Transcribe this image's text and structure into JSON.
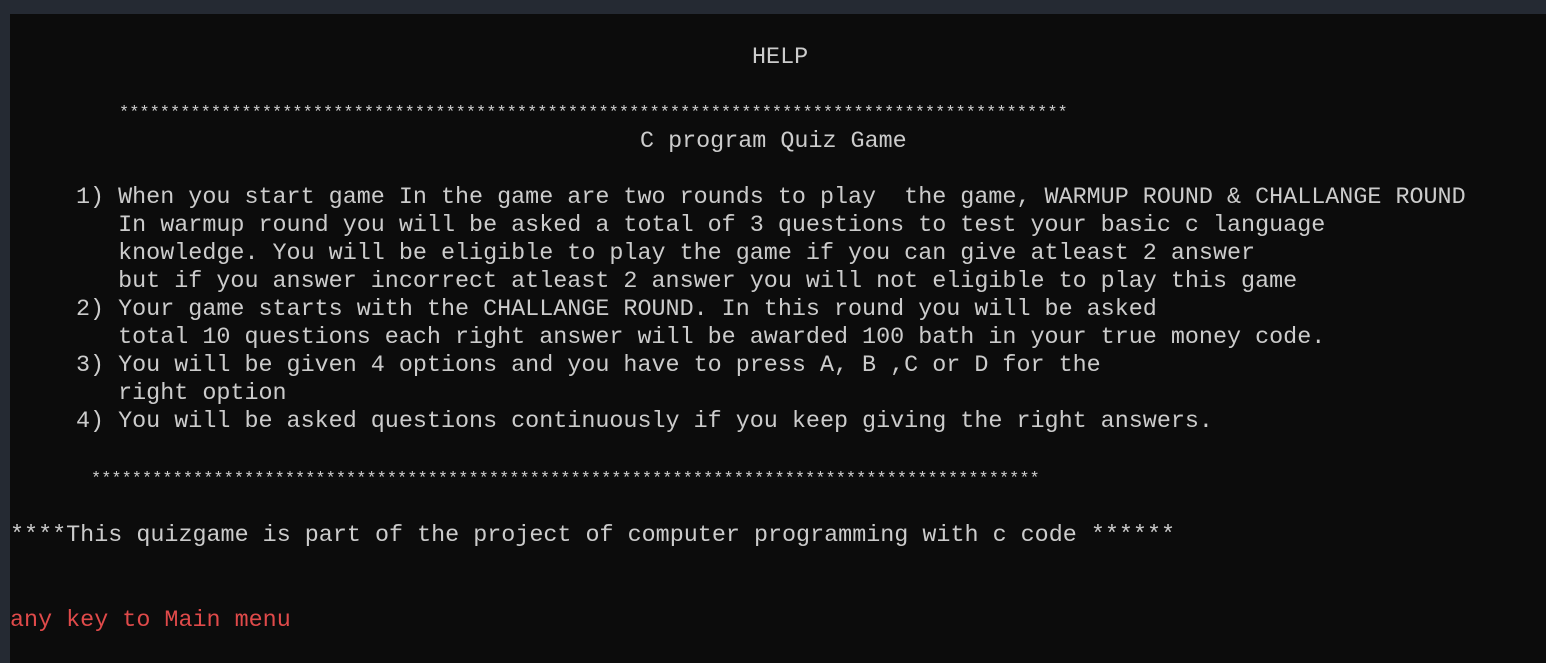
{
  "console": {
    "title": "HELP",
    "stars_top": "*********************************************************************************************",
    "subtitle": "C program Quiz Game",
    "lines": [
      "1) When you start game In the game are two rounds to play  the game, WARMUP ROUND & CHALLANGE ROUND",
      "   In warmup round you will be asked a total of 3 questions to test your basic c language",
      "   knowledge. You will be eligible to play the game if you can give atleast 2 answer",
      "   but if you answer incorrect atleast 2 answer you will not eligible to play this game",
      "2) Your game starts with the CHALLANGE ROUND. In this round you will be asked",
      "   total 10 questions each right answer will be awarded 100 bath in your true money code.",
      "3) You will be given 4 options and you have to press A, B ,C or D for the",
      "   right option",
      "4) You will be asked questions continuously if you keep giving the right answers."
    ],
    "stars_bottom": "*********************************************************************************************",
    "footer_note": "****This quizgame is part of the project of computer programming with c code ******",
    "prompt": "any key to Main menu"
  },
  "colors": {
    "window_frame": "#252a33",
    "console_bg": "#0c0c0c",
    "text": "#cccccc",
    "prompt": "#e04a4a"
  }
}
